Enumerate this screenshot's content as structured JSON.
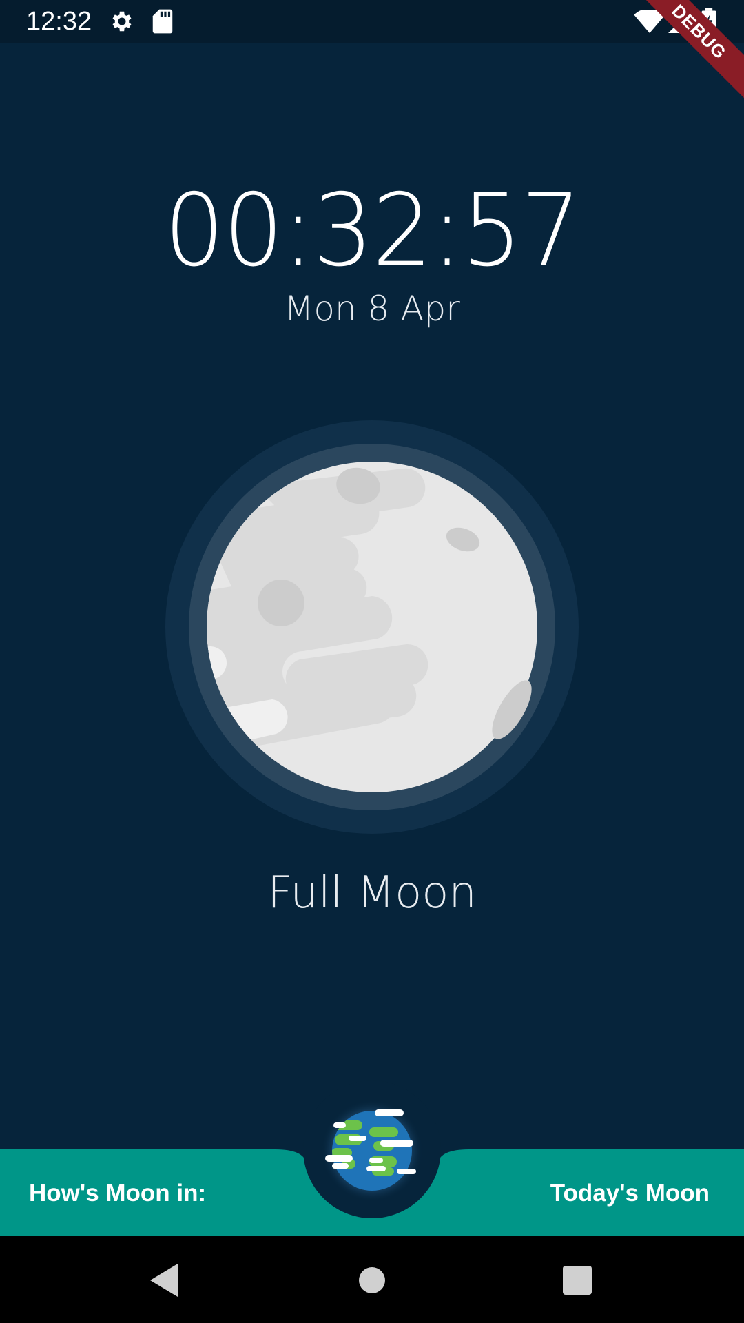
{
  "status_bar": {
    "time": "12:32",
    "icons": [
      "settings-icon",
      "sd-card-icon",
      "wifi-icon",
      "signal-icon",
      "battery-charging-icon"
    ]
  },
  "debug_banner": "DEBUG",
  "clock": {
    "time": "00:32:57",
    "date": "Mon 8 Apr"
  },
  "moon": {
    "phase": "Full Moon",
    "icon": "moon-icon"
  },
  "bottom_bar": {
    "left_label": "How's Moon in:",
    "right_label": "Today's Moon",
    "center_icon": "earth-icon"
  },
  "nav_bar": {
    "buttons": [
      "back-icon",
      "home-icon",
      "recents-icon"
    ]
  },
  "colors": {
    "background": "#06243b",
    "status_bar": "#051c2e",
    "bottom_bar": "#009688",
    "moon_surface": "#e6e6e6",
    "moon_ring": "#2e4a61"
  }
}
